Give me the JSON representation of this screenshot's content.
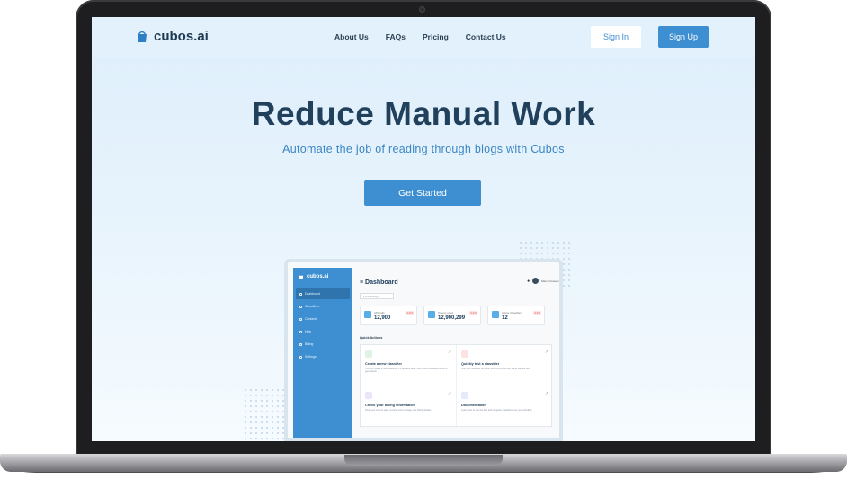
{
  "nav": {
    "brand": "cubos.ai",
    "links": [
      "About Us",
      "FAQs",
      "Pricing",
      "Contact Us"
    ],
    "sign_in": "Sign In",
    "sign_up": "Sign Up"
  },
  "hero": {
    "title": "Reduce Manual Work",
    "subtitle": "Automate the job of reading through blogs with Cubos",
    "cta": "Get Started"
  },
  "dashboard": {
    "brand": "cubos.ai",
    "nav_items": [
      "Dashboard",
      "Classifiers",
      "Contacts",
      "Help",
      "Billing",
      "Settings"
    ],
    "title": "Dashboard",
    "user_name": "Marco Kuswan",
    "filter": "Last 30 days",
    "stats": [
      {
        "label": "API calls",
        "value": "12,900",
        "change": "3.2%"
      },
      {
        "label": "Tokens used",
        "value": "12,900,299",
        "change": "3.2%"
      },
      {
        "label": "Active Classifiers",
        "value": "12",
        "change": "3.2%"
      }
    ],
    "quick_actions_title": "Quick Actions",
    "quick_actions": [
      {
        "title": "Create a new classifier",
        "desc": "You can create a new classifier. It's fast and easy. Just follow the steps below to get started."
      },
      {
        "title": "Quickly test a classifier",
        "desc": "Test your classifier and see how it performs with some sample text."
      },
      {
        "title": "Check your billing information",
        "desc": "View your current plan, invoices and manage your billing details."
      },
      {
        "title": "Documentation",
        "desc": "Learn how to use the API and integrate classifiers into your workflow."
      }
    ]
  },
  "colors": {
    "accent": "#3e8fd1",
    "title": "#21405c",
    "subtitle": "#3a86c4"
  }
}
